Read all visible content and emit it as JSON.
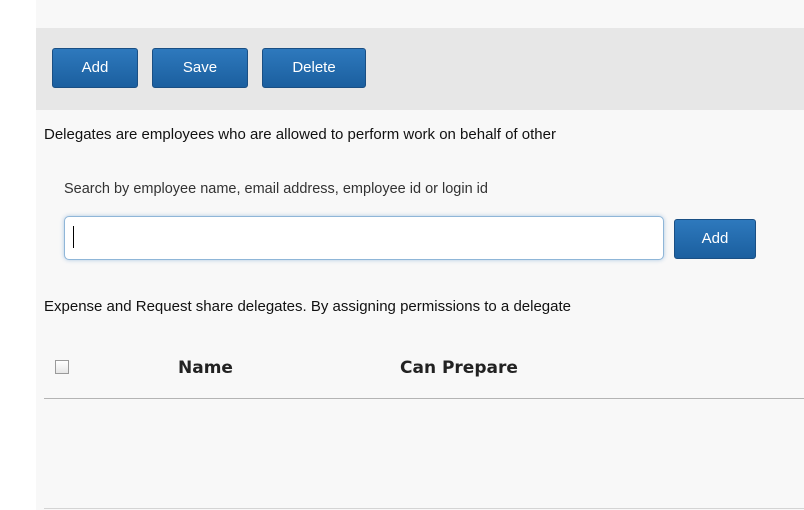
{
  "toolbar": {
    "add_label": "Add",
    "save_label": "Save",
    "delete_label": "Delete"
  },
  "intro_text": "Delegates are employees who are allowed to perform work on behalf of other",
  "search": {
    "label": "Search by employee name, email address, employee id or login id",
    "value": "",
    "add_label": "Add"
  },
  "share_note": "Expense and Request share delegates. By assigning permissions to a delegate",
  "table": {
    "columns": [
      "Name",
      "Can Prepare"
    ],
    "rows": []
  },
  "colors": {
    "button": "#1f66a8",
    "toolbar_bg": "#e7e7e7",
    "input_focus_border": "#8fb6d8"
  }
}
